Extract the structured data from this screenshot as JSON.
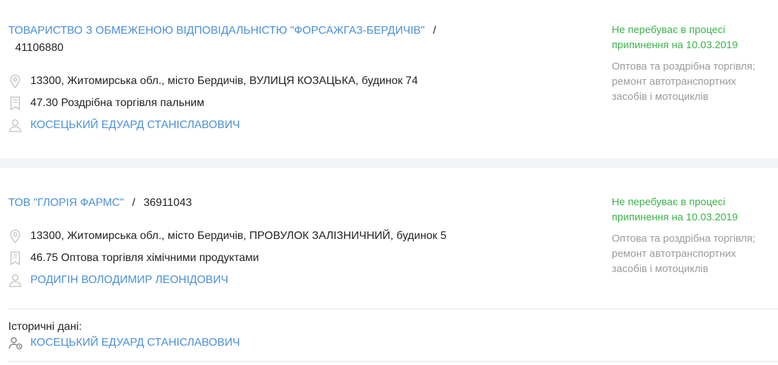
{
  "companies": [
    {
      "name": "ТОВАРИСТВО З ОБМЕЖЕНОЮ ВІДПОВІДАЛЬНІСТЮ \"ФОРСАЖГАЗ-БЕРДИЧІВ\"",
      "separator": "/",
      "code": "41106880",
      "address": "13300, Житомирська обл., місто Бердичів, ВУЛИЦЯ КОЗАЦЬКА, будинок 74",
      "activity": "47.30 Роздрібна торгівля пальним",
      "head": "КОСЕЦЬКИЙ ЕДУАРД СТАНІСЛАВОВИЧ",
      "status": "Не перебуває в процесі припинення на 10.03.2019",
      "kved": "Оптова та роздрібна торгівля; ремонт автотранспортних засобів і мотоциклів"
    },
    {
      "name": "ТОВ \"ГЛОРІЯ ФАРМС\"",
      "separator": "/",
      "code": "36911043",
      "address": "13300, Житомирська обл., місто Бердичів, ПРОВУЛОК ЗАЛІЗНИЧНИЙ, будинок 5",
      "activity": "46.75 Оптова торгівля хімічними продуктами",
      "head": "РОДИГІН ВОЛОДИМИР ЛЕОНІДОВИЧ",
      "status": "Не перебуває в процесі припинення на 10.03.2019",
      "kved": "Оптова та роздрібна торгівля; ремонт автотранспортних засобів і мотоциклів",
      "history_label": "Історичні дані:",
      "history_person": "КОСЕЦЬКИЙ ЕДУАРД СТАНІСЛАВОВИЧ"
    }
  ],
  "colors": {
    "link": "#4a90d9",
    "status": "#3cb34a",
    "muted": "#9a9a9a",
    "icon": "#c8c8c8"
  },
  "icons": [
    "location-pin-icon",
    "bookmark-icon",
    "person-icon",
    "person-history-icon"
  ]
}
